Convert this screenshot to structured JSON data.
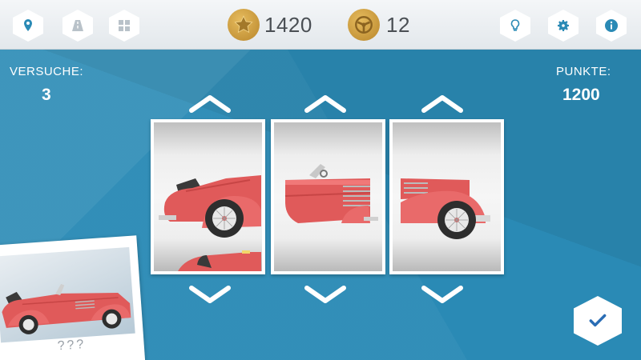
{
  "hud": {
    "stars": "1420",
    "wheels": "12"
  },
  "toolbar_left": [
    {
      "icon": "map-pin-icon"
    },
    {
      "icon": "road-icon"
    },
    {
      "icon": "grid-icon"
    }
  ],
  "toolbar_right": [
    {
      "icon": "lightbulb-icon"
    },
    {
      "icon": "gear-icon"
    },
    {
      "icon": "info-icon"
    }
  ],
  "stats": {
    "attempts_label": "VERSUCHE:",
    "attempts_value": "3",
    "points_label": "PUNKTE:",
    "points_value": "1200"
  },
  "photo": {
    "caption": "???"
  },
  "colors": {
    "background": "#2a8ab5",
    "car_red": "#e05a5a",
    "gold": "#c99a3d",
    "icon_blue": "#2a8ab5"
  }
}
